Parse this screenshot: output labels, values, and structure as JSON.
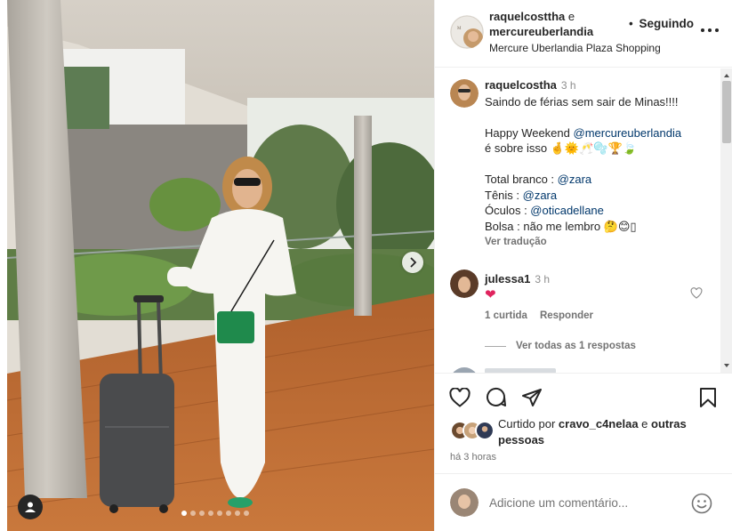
{
  "post": {
    "photo_alt": "Woman in white outfit with green bag and dark suitcase on a wooden deck",
    "carousel": {
      "dots_total": 8,
      "active_index": 0
    }
  },
  "header": {
    "author1": "raquelcosttha",
    "conjunction": "e",
    "author2": "mercureuberlandia",
    "follow_dot": "•",
    "follow_label": "Seguindo",
    "location": "Mercure Uberlandia Plaza Shopping"
  },
  "caption": {
    "username": "raquelcostha",
    "time": "3 h",
    "line1": "Saindo de férias sem sair de Minas!!!!",
    "line2_prefix": "Happy Weekend ",
    "line2_mention": "@mercureuberlandia",
    "line3_text": "é sobre isso ",
    "line3_emojis": "🤞🌞🥂🫧🏆🍃",
    "line4_prefix": "Total branco : ",
    "line4_mention": "@zara",
    "line5_prefix": "Tênis : ",
    "line5_mention": "@zara",
    "line6_prefix": "Óculos : ",
    "line6_mention": "@oticadellane",
    "line7_text": "Bolsa : não me lembro ",
    "line7_emojis": "🤔😊▯",
    "translate": "Ver tradução"
  },
  "comments": [
    {
      "username": "julessa1",
      "time": "3 h",
      "emoji": "❤",
      "likes": "1 curtida",
      "reply": "Responder",
      "view_replies": "Ver todas as 1 respostas"
    }
  ],
  "actions": {
    "liked_by_prefix": "Curtido por ",
    "liked_by_user": "cravo_c4nelaa",
    "liked_by_and": " e ",
    "liked_by_others": "outras pessoas",
    "time_ago": "há 3 horas"
  },
  "add_comment": {
    "placeholder": "Adicione um comentário..."
  },
  "colors": {
    "accent_link": "#00376b",
    "muted": "#737373",
    "heart": "#ed4956",
    "bag_green": "#1f8a4c"
  },
  "icons": [
    "heart-icon",
    "comment-icon",
    "share-icon",
    "bookmark-icon",
    "emoji-icon",
    "more-icon",
    "chevron-right-icon",
    "user-tag-icon"
  ]
}
